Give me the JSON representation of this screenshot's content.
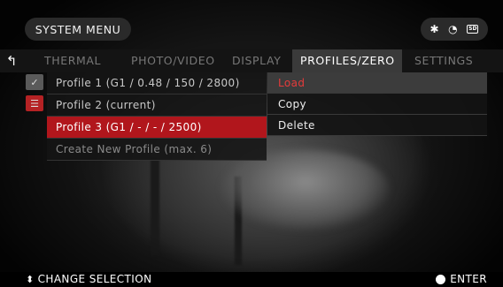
{
  "header": {
    "title": "SYSTEM MENU",
    "status_icons": [
      "bluetooth-icon",
      "wifi-icon",
      "sd-card-icon"
    ],
    "sd_label": "SD"
  },
  "tabs": [
    {
      "label": "THERMAL",
      "active": false
    },
    {
      "label": "PHOTO/VIDEO",
      "active": false
    },
    {
      "label": "DISPLAY",
      "active": false
    },
    {
      "label": "PROFILES/ZERO",
      "active": true
    },
    {
      "label": "SETTINGS",
      "active": false
    }
  ],
  "profiles": [
    {
      "label": "Profile 1 (G1 / 0.48 / 150 / 2800)",
      "state": "normal"
    },
    {
      "label": "Profile 2 (current)",
      "state": "normal"
    },
    {
      "label": "Profile 3 (G1 / - / - / 2500)",
      "state": "selected"
    },
    {
      "label": "Create New Profile (max. 6)",
      "state": "muted"
    }
  ],
  "context_menu": [
    {
      "label": "Load",
      "highlight": true
    },
    {
      "label": "Copy",
      "highlight": false
    },
    {
      "label": "Delete",
      "highlight": false
    }
  ],
  "footer": {
    "left_label": "CHANGE SELECTION",
    "right_label": "ENTER"
  },
  "colors": {
    "accent_red": "#b1161c",
    "highlight_text": "#e53b3b",
    "tab_active_bg": "#3a3a3a"
  }
}
